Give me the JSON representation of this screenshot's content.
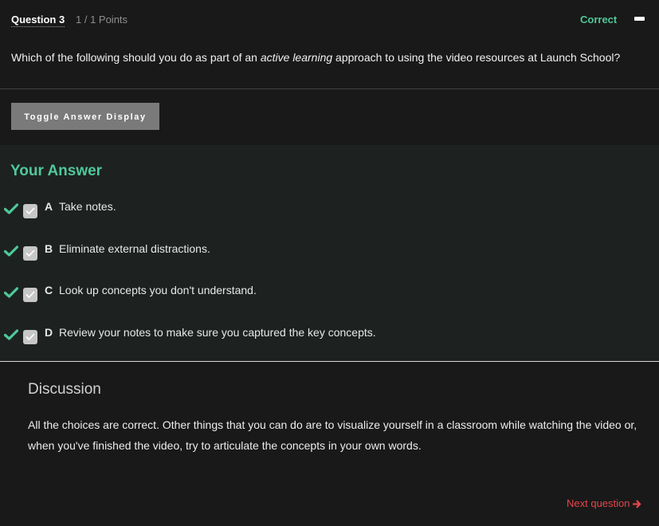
{
  "question": {
    "title": "Question 3",
    "points": "1 / 1 Points",
    "status": "Correct",
    "status_color": "#4fc89a",
    "prompt_before": "Which of the following should you do as part of an ",
    "prompt_emphasis": "active learning",
    "prompt_after": " approach to using the video resources at Launch School?"
  },
  "toggle_button": {
    "label": "Toggle Answer Display"
  },
  "your_answer": {
    "heading": "Your Answer",
    "choices": [
      {
        "letter": "A",
        "text": "Take notes.",
        "checked": true,
        "correct": true
      },
      {
        "letter": "B",
        "text": "Eliminate external distractions.",
        "checked": true,
        "correct": true
      },
      {
        "letter": "C",
        "text": "Look up concepts you don't understand.",
        "checked": true,
        "correct": true
      },
      {
        "letter": "D",
        "text": "Review your notes to make sure you captured the key concepts.",
        "checked": true,
        "correct": true
      }
    ]
  },
  "discussion": {
    "title": "Discussion",
    "text": "All the choices are correct. Other things that you can do are to visualize yourself in a classroom while watching the video or, when you've finished the video, try to articulate the concepts in your own words."
  },
  "navigation": {
    "next_label": "Next question",
    "next_icon": "arrow-right-icon",
    "next_color": "#e8454c"
  },
  "icons": {
    "collapse": "minus-icon",
    "correct_mark": "checkmark-icon",
    "checkbox": "checkbox-checked-icon"
  }
}
